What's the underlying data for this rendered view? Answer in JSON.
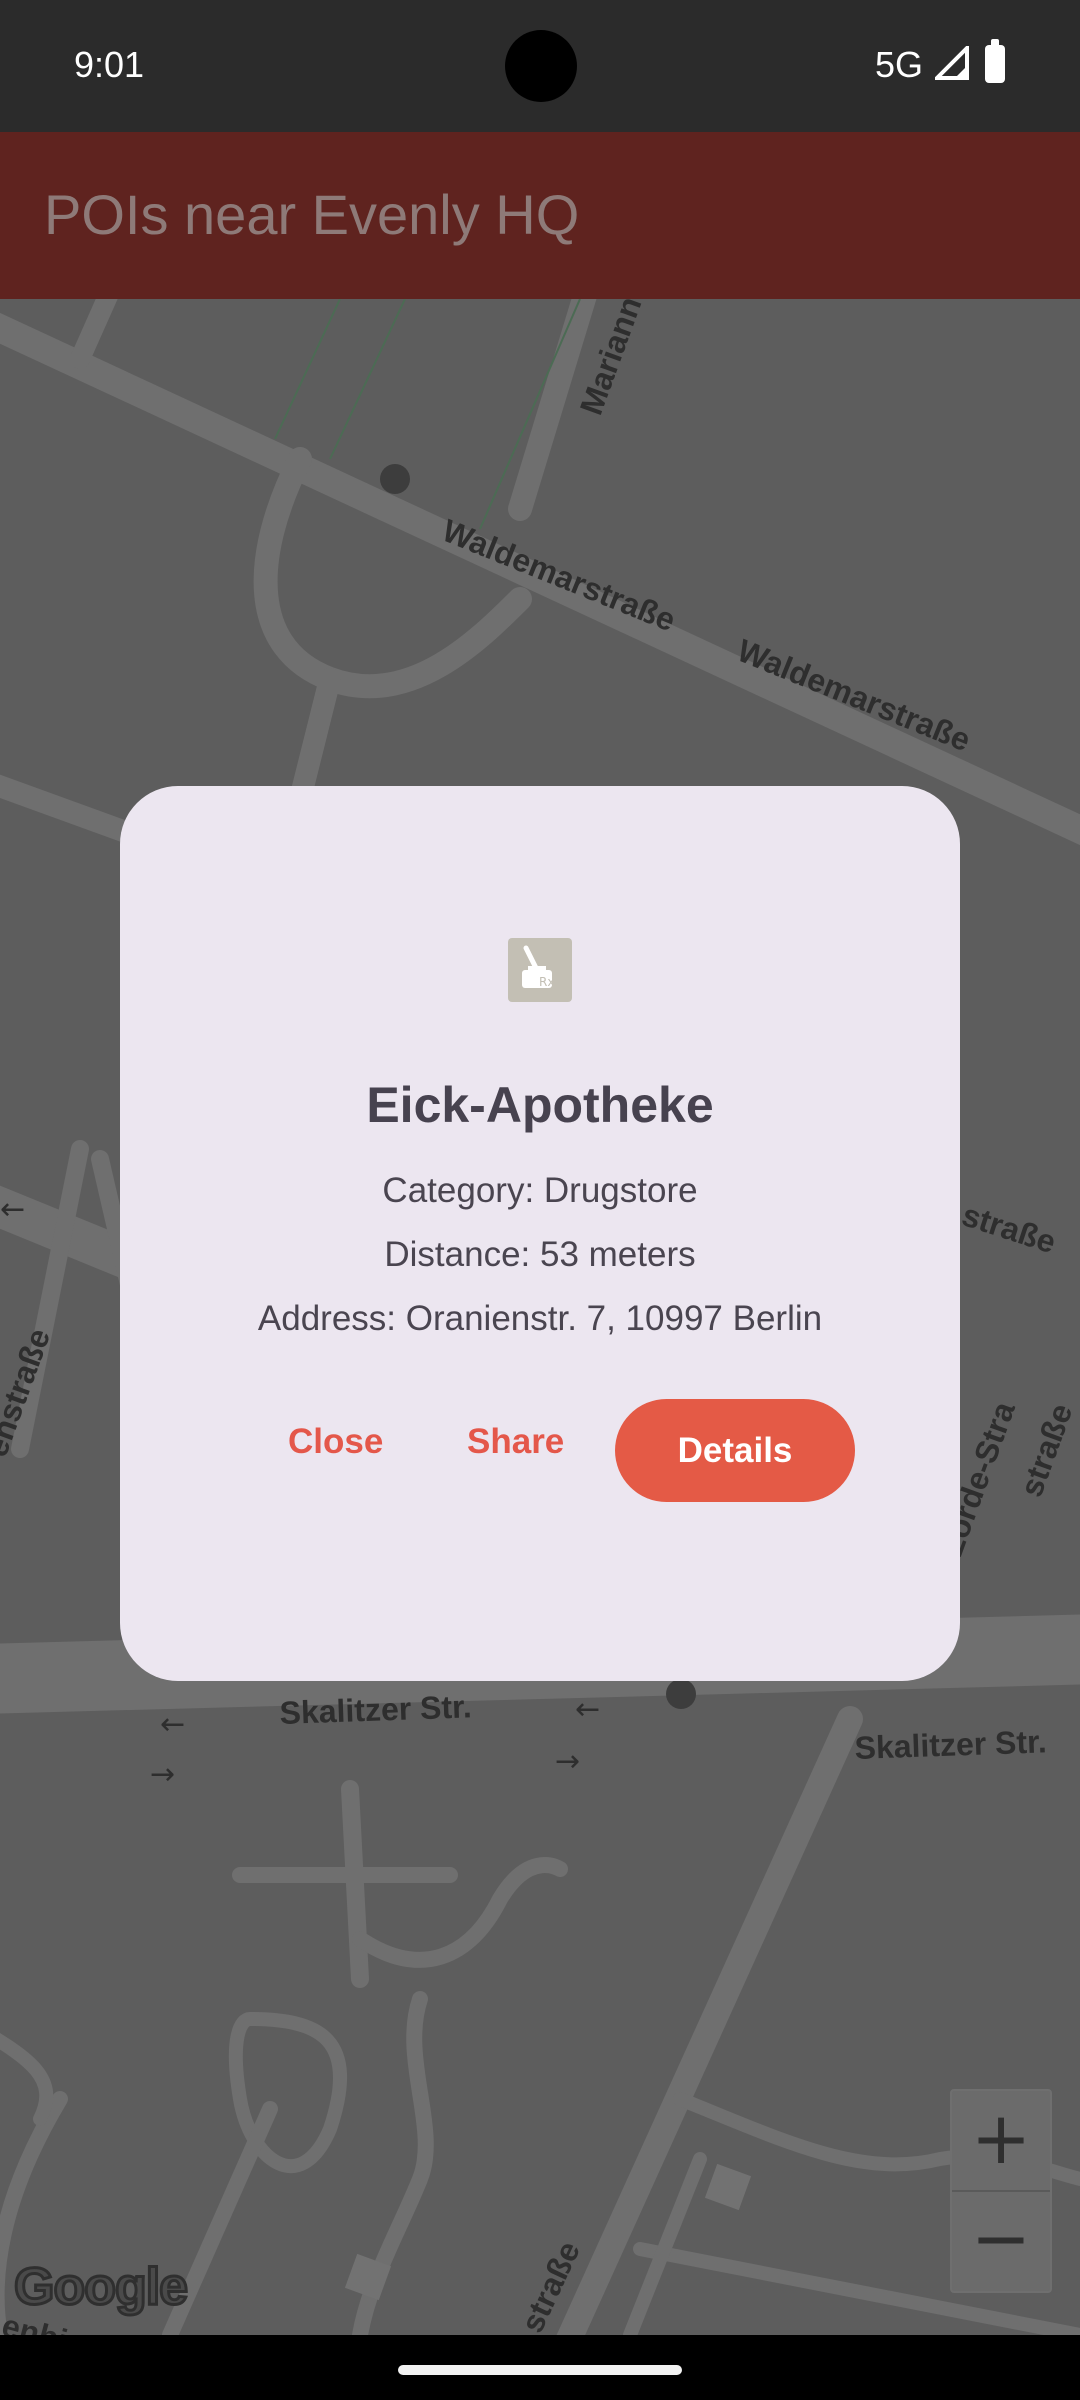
{
  "status_bar": {
    "time": "9:01",
    "network": "5G"
  },
  "app_bar": {
    "title": "POIs near Evenly HQ"
  },
  "map": {
    "street_labels": [
      "Waldemarstraße",
      "Waldemarstraße",
      "Mariann",
      "Skalitzer Str.",
      "Skalitzer Str.",
      "straße",
      "Lorde-Stra",
      "straße",
      "enstraße",
      "straße",
      "enbi"
    ],
    "attribution": "Google",
    "zoom_in": "+",
    "zoom_out": "−"
  },
  "dialog": {
    "icon": "pharmacy-icon",
    "name": "Eick-Apotheke",
    "category": "Category: Drugstore",
    "distance": "Distance: 53 meters",
    "address": "Address: Oranienstr. 7, 10997 Berlin",
    "close_label": "Close",
    "share_label": "Share",
    "details_label": "Details"
  },
  "colors": {
    "app_bar": "#5f231f",
    "dialog_bg": "#ece6f0",
    "accent": "#e45a46"
  }
}
